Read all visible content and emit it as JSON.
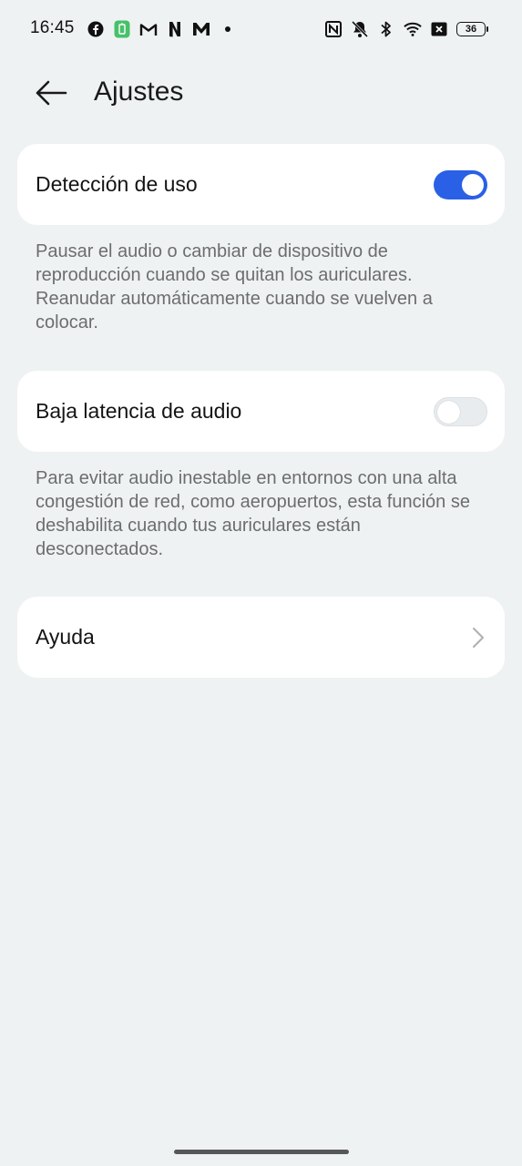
{
  "status_bar": {
    "time": "16:45",
    "left_icons": [
      "facebook-icon",
      "battery-saver-icon",
      "gmail-icon",
      "netflix-icon",
      "mail-app-icon",
      "dot-icon"
    ],
    "right_icons": [
      "nfc-icon",
      "bell-muted-icon",
      "bluetooth-icon",
      "wifi-icon",
      "sim-off-icon"
    ],
    "battery": "36"
  },
  "header": {
    "title": "Ajustes"
  },
  "settings": {
    "usage_detection": {
      "label": "Detección de uso",
      "enabled": true,
      "description": "Pausar el audio o cambiar de dispositivo de reproducción cuando se quitan los auriculares. Reanudar automáticamente cuando se vuelven a colocar."
    },
    "low_latency": {
      "label": "Baja latencia de audio",
      "enabled": false,
      "description": "Para evitar audio inestable en entornos con una alta congestión de red, como aeropuertos, esta función se deshabilita cuando tus auriculares están desconectados."
    },
    "help": {
      "label": "Ayuda"
    }
  },
  "colors": {
    "background": "#eff2f3",
    "card": "#ffffff",
    "accent": "#2a60e6",
    "secondary_text": "#6d6d6d"
  }
}
